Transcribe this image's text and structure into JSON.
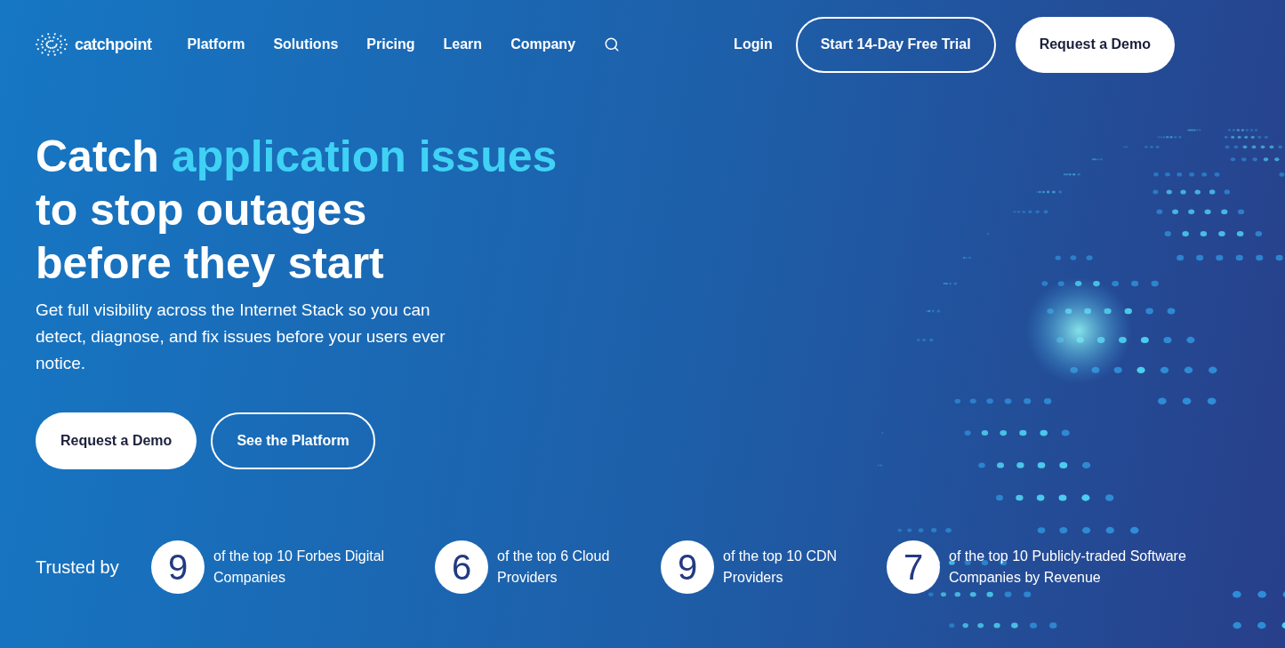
{
  "brand": {
    "name": "catchpoint"
  },
  "nav": {
    "items": [
      "Platform",
      "Solutions",
      "Pricing",
      "Learn",
      "Company"
    ],
    "login": "Login",
    "trial_button": "Start 14-Day Free Trial",
    "demo_button": "Request a Demo"
  },
  "hero": {
    "headline_lead": "Catch",
    "headline_highlight": "application issues",
    "headline_lines": [
      "to stop outages",
      "before they start"
    ],
    "subtitle": "Get full visibility across the Internet Stack so you can detect, diagnose, and fix issues before your users ever notice.",
    "buttons": [
      {
        "label": "Request a Demo",
        "kind": "solid"
      },
      {
        "label": "See the Platform",
        "kind": "outline"
      }
    ]
  },
  "trusted": {
    "label": "Trusted by",
    "stats": [
      {
        "number": "9",
        "text": "of the top 10 Forbes Digital Companies"
      },
      {
        "number": "6",
        "text": "of the top 6 Cloud Providers"
      },
      {
        "number": "9",
        "text": "of the top 10 CDN Providers"
      },
      {
        "number": "7",
        "text": "of the top 10 Publicly-traded Software Companies by Revenue"
      }
    ]
  }
}
